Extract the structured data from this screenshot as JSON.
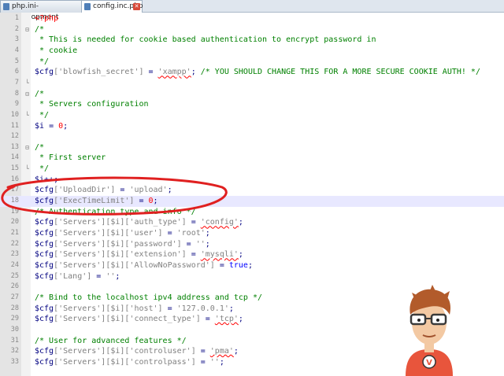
{
  "tabs": [
    {
      "label": "php.ini-development",
      "active": false
    },
    {
      "label": "config.inc.php",
      "active": true
    }
  ],
  "highlighted_line": 18,
  "code_lines": [
    [
      {
        "t": "<?php",
        "c": "p"
      }
    ],
    [
      {
        "t": "/*",
        "c": "c"
      }
    ],
    [
      {
        "t": " * This is needed for cookie based authentication to encrypt password in",
        "c": "c"
      }
    ],
    [
      {
        "t": " * cookie",
        "c": "c"
      }
    ],
    [
      {
        "t": " */",
        "c": "c"
      }
    ],
    [
      {
        "t": "$cfg",
        "c": "v"
      },
      {
        "t": "['blowfish_secret']",
        "c": "s"
      },
      {
        "t": " = ",
        "c": "o"
      },
      {
        "t": "'xampp'",
        "c": "s"
      },
      {
        "t": "; ",
        "c": "o"
      },
      {
        "t": "/* YOU SHOULD CHANGE THIS FOR A MORE SECURE COOKIE AUTH! */",
        "c": "c"
      }
    ],
    [],
    [
      {
        "t": "/*",
        "c": "c"
      }
    ],
    [
      {
        "t": " * Servers configuration",
        "c": "c"
      }
    ],
    [
      {
        "t": " */",
        "c": "c"
      }
    ],
    [
      {
        "t": "$i",
        "c": "v"
      },
      {
        "t": " = ",
        "c": "o"
      },
      {
        "t": "0",
        "c": "n"
      },
      {
        "t": ";",
        "c": "o"
      }
    ],
    [],
    [
      {
        "t": "/*",
        "c": "c"
      }
    ],
    [
      {
        "t": " * First server",
        "c": "c"
      }
    ],
    [
      {
        "t": " */",
        "c": "c"
      }
    ],
    [
      {
        "t": "$i",
        "c": "v"
      },
      {
        "t": "++;",
        "c": "o"
      }
    ],
    [
      {
        "t": "$cfg",
        "c": "v"
      },
      {
        "t": "['UploadDir']",
        "c": "s"
      },
      {
        "t": " = ",
        "c": "o"
      },
      {
        "t": "'upload'",
        "c": "s"
      },
      {
        "t": ";",
        "c": "o"
      }
    ],
    [
      {
        "t": "$cfg",
        "c": "v"
      },
      {
        "t": "['ExecTimeLimit']",
        "c": "s"
      },
      {
        "t": " = ",
        "c": "o"
      },
      {
        "t": "0",
        "c": "n"
      },
      {
        "t": ";",
        "c": "o"
      }
    ],
    [
      {
        "t": "/* Authentication type and info */",
        "c": "c"
      }
    ],
    [
      {
        "t": "$cfg",
        "c": "v"
      },
      {
        "t": "['Servers'][$i]['auth_type']",
        "c": "s"
      },
      {
        "t": " = ",
        "c": "o"
      },
      {
        "t": "'config'",
        "c": "s"
      },
      {
        "t": ";",
        "c": "o"
      }
    ],
    [
      {
        "t": "$cfg",
        "c": "v"
      },
      {
        "t": "['Servers'][$i]['user']",
        "c": "s"
      },
      {
        "t": " = ",
        "c": "o"
      },
      {
        "t": "'root'",
        "c": "s"
      },
      {
        "t": ";",
        "c": "o"
      }
    ],
    [
      {
        "t": "$cfg",
        "c": "v"
      },
      {
        "t": "['Servers'][$i]['password']",
        "c": "s"
      },
      {
        "t": " = ",
        "c": "o"
      },
      {
        "t": "''",
        "c": "s"
      },
      {
        "t": ";",
        "c": "o"
      }
    ],
    [
      {
        "t": "$cfg",
        "c": "v"
      },
      {
        "t": "['Servers'][$i]['extension']",
        "c": "s"
      },
      {
        "t": " = ",
        "c": "o"
      },
      {
        "t": "'mysqli'",
        "c": "s"
      },
      {
        "t": ";",
        "c": "o"
      }
    ],
    [
      {
        "t": "$cfg",
        "c": "v"
      },
      {
        "t": "['Servers'][$i]['AllowNoPassword']",
        "c": "s"
      },
      {
        "t": " = ",
        "c": "o"
      },
      {
        "t": "true",
        "c": "k"
      },
      {
        "t": ";",
        "c": "o"
      }
    ],
    [
      {
        "t": "$cfg",
        "c": "v"
      },
      {
        "t": "['Lang']",
        "c": "s"
      },
      {
        "t": " = ",
        "c": "o"
      },
      {
        "t": "''",
        "c": "s"
      },
      {
        "t": ";",
        "c": "o"
      }
    ],
    [],
    [
      {
        "t": "/* Bind to the localhost ipv4 address and tcp */",
        "c": "c"
      }
    ],
    [
      {
        "t": "$cfg",
        "c": "v"
      },
      {
        "t": "['Servers'][$i]['host']",
        "c": "s"
      },
      {
        "t": " = ",
        "c": "o"
      },
      {
        "t": "'127.0.0.1'",
        "c": "s"
      },
      {
        "t": ";",
        "c": "o"
      }
    ],
    [
      {
        "t": "$cfg",
        "c": "v"
      },
      {
        "t": "['Servers'][$i]['connect_type']",
        "c": "s"
      },
      {
        "t": " = ",
        "c": "o"
      },
      {
        "t": "'tcp'",
        "c": "s"
      },
      {
        "t": ";",
        "c": "o"
      }
    ],
    [],
    [
      {
        "t": "/* User for advanced features */",
        "c": "c"
      }
    ],
    [
      {
        "t": "$cfg",
        "c": "v"
      },
      {
        "t": "['Servers'][$i]['controluser']",
        "c": "s"
      },
      {
        "t": " = ",
        "c": "o"
      },
      {
        "t": "'pma'",
        "c": "s"
      },
      {
        "t": ";",
        "c": "o"
      }
    ],
    [
      {
        "t": "$cfg",
        "c": "v"
      },
      {
        "t": "['Servers'][$i]['controlpass']",
        "c": "s"
      },
      {
        "t": " = ",
        "c": "o"
      },
      {
        "t": "''",
        "c": "s"
      },
      {
        "t": ";",
        "c": "o"
      }
    ]
  ],
  "fold_markers": {
    "2": "minus",
    "7": "end",
    "8": "minus",
    "10": "end",
    "13": "minus",
    "15": "end"
  },
  "colors": {
    "annotation": "#e02020",
    "highlight": "#e8e8ff",
    "gutter": "#e4e4e4"
  },
  "mascot_badge": "V"
}
